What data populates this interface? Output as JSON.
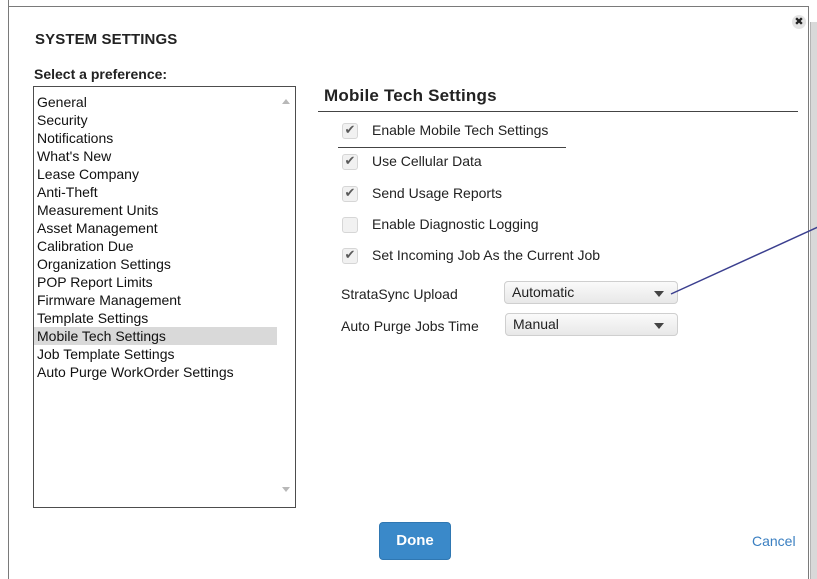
{
  "dialog": {
    "title": "SYSTEM SETTINGS",
    "close_glyph": "✖"
  },
  "sidebar": {
    "label": "Select a preference:",
    "items": [
      {
        "label": "General",
        "selected": false
      },
      {
        "label": "Security",
        "selected": false
      },
      {
        "label": "Notifications",
        "selected": false
      },
      {
        "label": "What's New",
        "selected": false
      },
      {
        "label": "Lease Company",
        "selected": false
      },
      {
        "label": "Anti-Theft",
        "selected": false
      },
      {
        "label": "Measurement Units",
        "selected": false
      },
      {
        "label": "Asset Management",
        "selected": false
      },
      {
        "label": "Calibration Due",
        "selected": false
      },
      {
        "label": "Organization Settings",
        "selected": false
      },
      {
        "label": "POP Report Limits",
        "selected": false
      },
      {
        "label": "Firmware Management",
        "selected": false
      },
      {
        "label": "Template Settings",
        "selected": false
      },
      {
        "label": "Mobile Tech Settings",
        "selected": true
      },
      {
        "label": "Job Template Settings",
        "selected": false
      },
      {
        "label": "Auto Purge WorkOrder Settings",
        "selected": false
      }
    ]
  },
  "panel": {
    "title": "Mobile Tech Settings",
    "checkboxes": [
      {
        "label": "Enable Mobile Tech Settings",
        "checked": true
      },
      {
        "label": "Use Cellular Data",
        "checked": true
      },
      {
        "label": "Send Usage Reports",
        "checked": true
      },
      {
        "label": "Enable Diagnostic Logging",
        "checked": false
      },
      {
        "label": "Set Incoming Job As the Current Job",
        "checked": true
      }
    ],
    "strata_upload": {
      "label": "StrataSync Upload",
      "value": "Automatic"
    },
    "auto_purge": {
      "label": "Auto Purge Jobs Time",
      "value": "Manual"
    }
  },
  "footer": {
    "done_label": "Done",
    "cancel_label": "Cancel"
  },
  "colors": {
    "accent": "#3a89c9",
    "link": "#3a7fc1",
    "selected_row": "#d9d9d9",
    "annotation_line": "#3b3f8f"
  },
  "icons": {
    "close": "close-icon",
    "check": "checkmark-icon",
    "caret": "chevron-down-icon"
  }
}
